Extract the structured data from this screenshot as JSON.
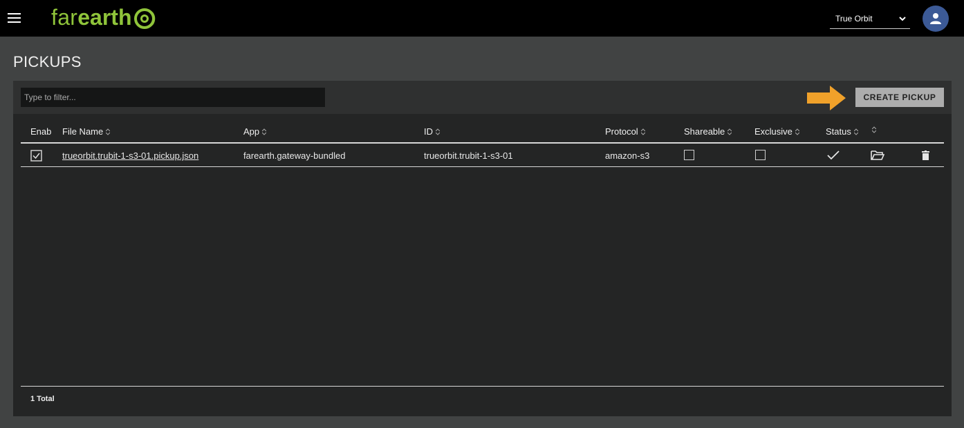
{
  "app": {
    "logo_prefix": "far",
    "logo_suffix": "earth"
  },
  "header": {
    "org_selected": "True Orbit"
  },
  "page": {
    "title": "PICKUPS"
  },
  "toolbar": {
    "filter_placeholder": "Type to filter...",
    "create_label": "CREATE PICKUP"
  },
  "table": {
    "columns": [
      "Enab",
      "File Name",
      "App",
      "ID",
      "Protocol",
      "Shareable",
      "Exclusive",
      "Status"
    ],
    "rows": [
      {
        "enabled": true,
        "file_name": "trueorbit.trubit-1-s3-01.pickup.json",
        "app": "farearth.gateway-bundled",
        "id": "trueorbit.trubit-1-s3-01",
        "protocol": "amazon-s3",
        "shareable": false,
        "exclusive": false,
        "status": "ok"
      }
    ]
  },
  "footer": {
    "total": "1 Total"
  },
  "icons": [
    "menu-icon",
    "logo-mark-icon",
    "chevron-down-icon",
    "user-icon",
    "arrow-right-icon",
    "sort-icon",
    "checkbox-icon",
    "checkmark-icon",
    "folder-open-icon",
    "trash-icon"
  ],
  "colors": {
    "brand": "#8fc43a",
    "arrow": "#f0a12a",
    "avatar": "#3c5a96",
    "button": "#adadad"
  }
}
